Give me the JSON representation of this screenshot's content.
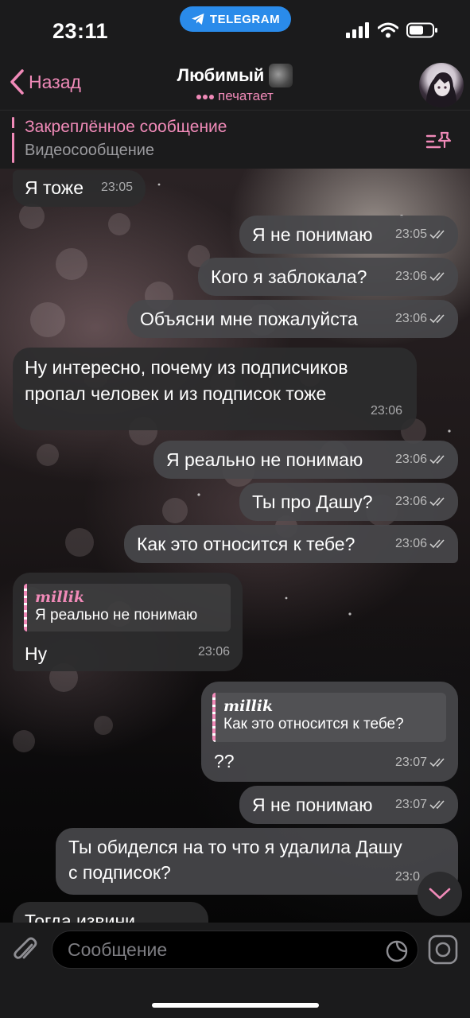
{
  "status_bar": {
    "time": "23:11",
    "app_pill": "TELEGRAM"
  },
  "header": {
    "back_label": "Назад",
    "chat_title": "Любимый",
    "chat_status": "печатает"
  },
  "pinned": {
    "title": "Закреплённое сообщение",
    "subtitle": "Видеосообщение"
  },
  "messages": [
    {
      "side": "in",
      "text": "Я тоже",
      "time": "23:05"
    },
    {
      "side": "out",
      "text": "Я не понимаю",
      "time": "23:05"
    },
    {
      "side": "out",
      "text": "Кого я заблокала?",
      "time": "23:06"
    },
    {
      "side": "out",
      "text": "Объясни мне пожалуйста",
      "time": "23:06"
    },
    {
      "side": "in",
      "text_line1": "Ну интересно, почему из подписчиков",
      "text_line2": "пропал человек и из подписок тоже",
      "time": "23:06"
    },
    {
      "side": "out",
      "text": "Я реально не понимаю",
      "time": "23:06"
    },
    {
      "side": "out",
      "text": "Ты про Дашу?",
      "time": "23:06"
    },
    {
      "side": "out",
      "text": "Как это относится к тебе?",
      "time": "23:06"
    },
    {
      "side": "in",
      "reply_name": "millik",
      "reply_text": "Я реально не понимаю",
      "text": "Ну",
      "time": "23:06"
    },
    {
      "side": "out",
      "reply_name": "millik",
      "reply_text": "Как это относится к тебе?",
      "text": "??",
      "time": "23:07"
    },
    {
      "side": "out",
      "text": "Я не понимаю",
      "time": "23:07"
    },
    {
      "side": "out",
      "text_line1": "Ты обиделся на то что я удалила Дашу",
      "text_line2": "с подписок?",
      "time": "23:0"
    },
    {
      "side": "in",
      "text": "Тогда извини",
      "time": ""
    }
  ],
  "composer": {
    "placeholder": "Сообщение"
  },
  "colors": {
    "accent_pink": "#f08ab8",
    "telegram_blue": "#2a8bea",
    "bar_bg": "#1b1b1c"
  },
  "icons": [
    "telegram-icon",
    "signal-icon",
    "wifi-icon",
    "battery-icon",
    "chevron-left-icon",
    "typing-dots-icon",
    "pin-list-icon",
    "read-checks-icon",
    "chevron-down-icon",
    "paperclip-icon",
    "sticker-icon",
    "camera-icon"
  ]
}
